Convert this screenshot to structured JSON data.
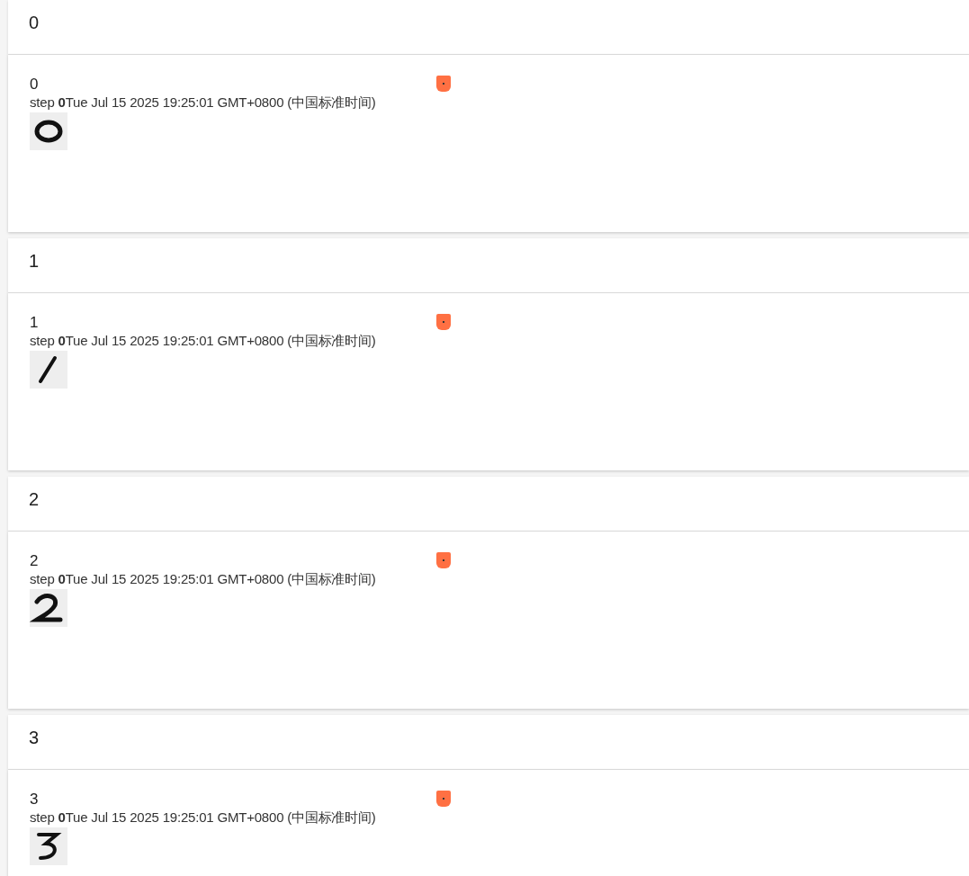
{
  "groups": [
    {
      "title": "0",
      "card": {
        "label": "0",
        "caption": "step **0**Tue Jul 15 2025 19:25:01 GMT+0800 (中国标准时间)",
        "color": "#ff7043"
      }
    },
    {
      "title": "1",
      "card": {
        "label": "1",
        "caption": "step **0**Tue Jul 15 2025 19:25:01 GMT+0800 (中国标准时间)",
        "color": "#ff7043"
      }
    },
    {
      "title": "2",
      "card": {
        "label": "2",
        "caption": "step **0**Tue Jul 15 2025 19:25:01 GMT+0800 (中国标准时间)",
        "color": "#ff7043"
      }
    },
    {
      "title": "3",
      "card": {
        "label": "3",
        "caption": "step **0**Tue Jul 15 2025 19:25:01 GMT+0800 (中国标准时间)",
        "color": "#ff7043"
      }
    }
  ]
}
